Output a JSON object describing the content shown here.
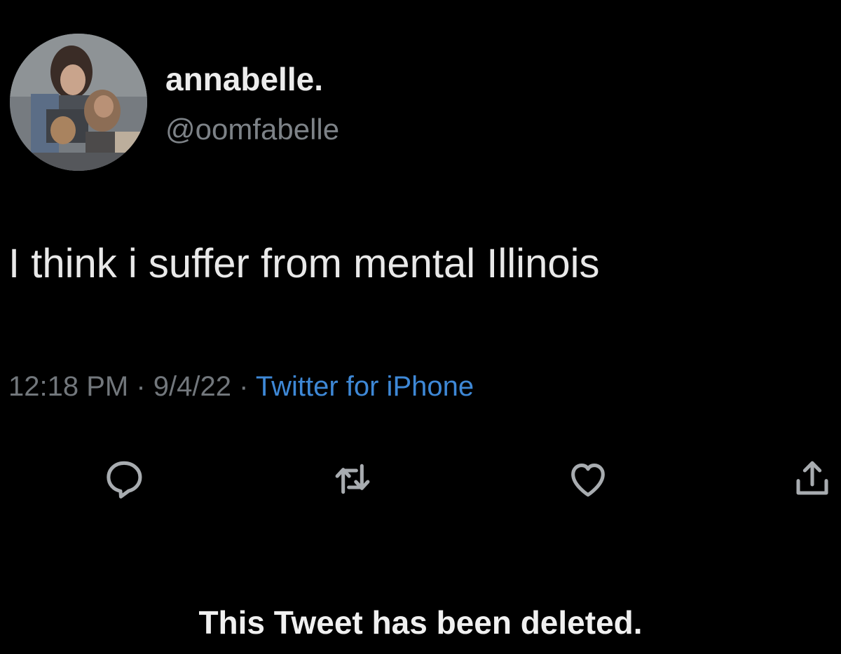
{
  "tweet": {
    "author": {
      "display_name": "annabelle.",
      "handle": "@oomfabelle",
      "avatar_icon": "profile-photo"
    },
    "text": "I think i suffer from mental Illinois",
    "time": "12:18 PM",
    "separator": "·",
    "date": "9/4/22",
    "source": "Twitter for iPhone",
    "source_color": "#3e88d6"
  },
  "actions": [
    {
      "icon": "reply-icon"
    },
    {
      "icon": "retweet-icon"
    },
    {
      "icon": "like-icon"
    },
    {
      "icon": "share-icon"
    }
  ],
  "notice": "This Tweet has been deleted.",
  "colors": {
    "background": "#000000",
    "primary_text": "#e9e9e9",
    "secondary_text": "#72777c",
    "icon": "#a8acb0"
  }
}
